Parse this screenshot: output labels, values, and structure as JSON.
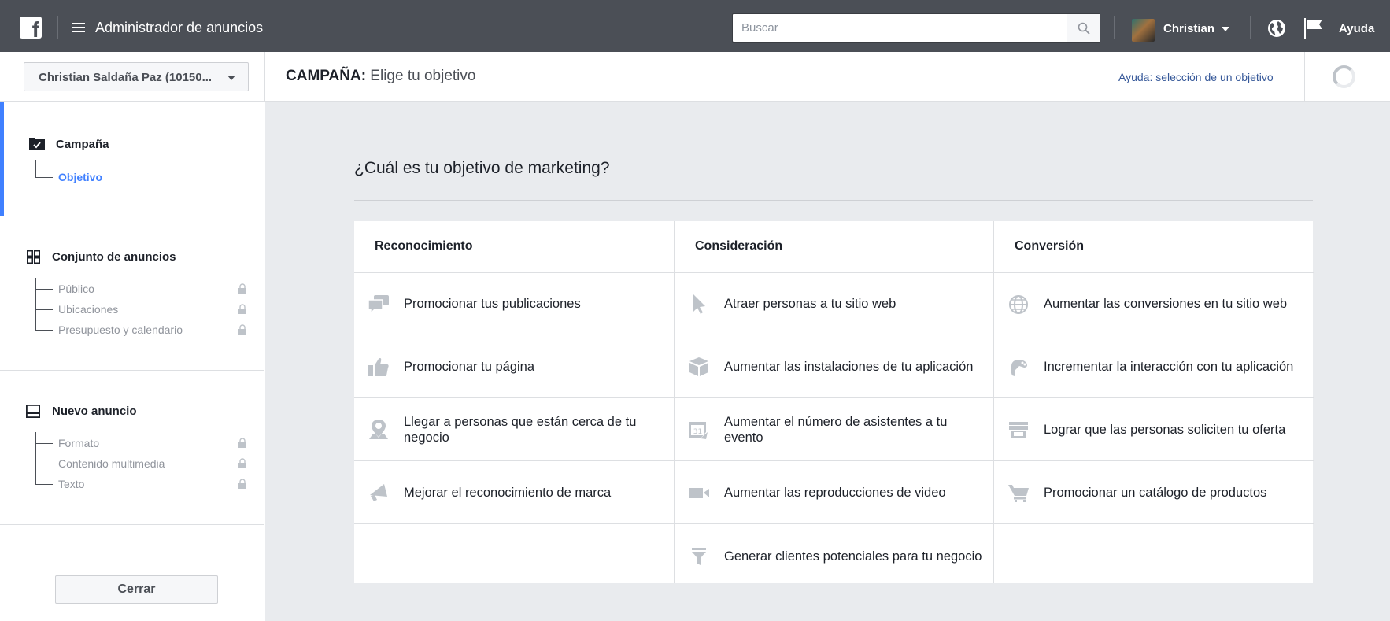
{
  "topbar": {
    "app_title": "Administrador de anuncios",
    "search_placeholder": "Buscar",
    "user_name": "Christian",
    "help_label": "Ayuda"
  },
  "header": {
    "account_selector": "Christian Saldaña Paz (10150...",
    "title_prefix": "CAMPAÑA:",
    "title_rest": " Elige tu objetivo",
    "help_objective_link": "Ayuda: selección de un objetivo"
  },
  "sidebar": {
    "campaign": {
      "title": "Campaña",
      "sub": [
        {
          "label": "Objetivo"
        }
      ]
    },
    "adset": {
      "title": "Conjunto de anuncios",
      "sub": [
        {
          "label": "Público"
        },
        {
          "label": "Ubicaciones"
        },
        {
          "label": "Presupuesto y calendario"
        }
      ]
    },
    "ad": {
      "title": "Nuevo anuncio",
      "sub": [
        {
          "label": "Formato"
        },
        {
          "label": "Contenido multimedia"
        },
        {
          "label": "Texto"
        }
      ]
    },
    "close_label": "Cerrar"
  },
  "main": {
    "question": "¿Cuál es tu objetivo de marketing?",
    "columns": [
      {
        "title": "Reconocimiento",
        "objectives": [
          {
            "label": "Promocionar tus publicaciones",
            "icon": "speech-bubbles-icon"
          },
          {
            "label": "Promocionar tu página",
            "icon": "thumbs-up-icon"
          },
          {
            "label": "Llegar a personas que están cerca de tu negocio",
            "icon": "map-pin-icon"
          },
          {
            "label": "Mejorar el reconocimiento de marca",
            "icon": "megaphone-icon"
          }
        ]
      },
      {
        "title": "Consideración",
        "objectives": [
          {
            "label": "Atraer personas a tu sitio web",
            "icon": "cursor-icon"
          },
          {
            "label": "Aumentar las instalaciones de tu aplicación",
            "icon": "box-icon"
          },
          {
            "label": "Aumentar el número de asistentes a tu evento",
            "icon": "calendar-icon"
          },
          {
            "label": "Aumentar las reproducciones de video",
            "icon": "video-camera-icon"
          },
          {
            "label": "Generar clientes potenciales para tu negocio",
            "icon": "funnel-icon"
          }
        ]
      },
      {
        "title": "Conversión",
        "objectives": [
          {
            "label": "Aumentar las conversiones en tu sitio web",
            "icon": "globe-icon"
          },
          {
            "label": "Incrementar la interacción con tu aplicación",
            "icon": "game-controller-icon"
          },
          {
            "label": "Lograr que las personas soliciten tu oferta",
            "icon": "storefront-icon"
          },
          {
            "label": "Promocionar un catálogo de productos",
            "icon": "shopping-cart-icon"
          }
        ]
      }
    ]
  },
  "colors": {
    "topbar": "#4b4f56",
    "accent": "#4080ff",
    "link": "#365899",
    "icon": "#bec3c9",
    "canvas": "#e9ebee"
  }
}
